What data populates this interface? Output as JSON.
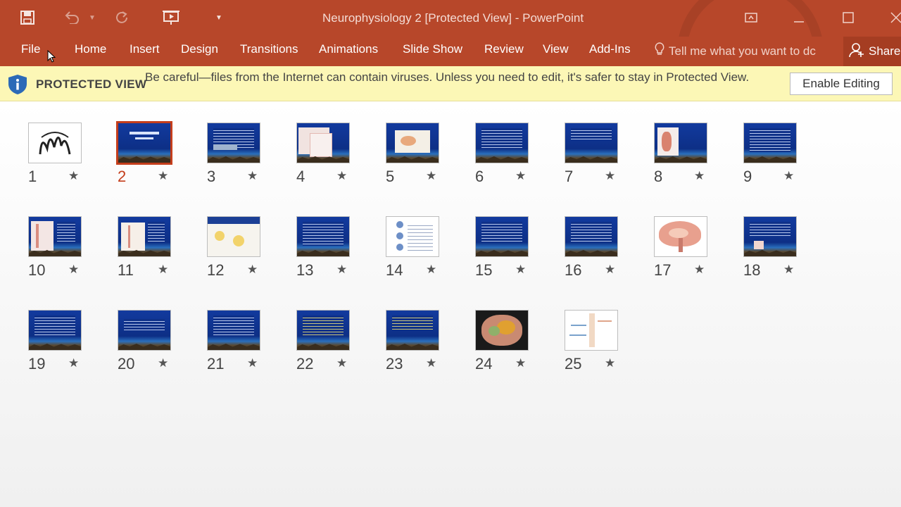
{
  "window": {
    "title": "Neurophysiology 2 [Protected View] - PowerPoint"
  },
  "quick_access": [
    "save-icon",
    "undo-icon",
    "dropdown-caret-icon",
    "redo-icon",
    "present-icon",
    "customize-icon"
  ],
  "ribbon": {
    "tabs": [
      "File",
      "Home",
      "Insert",
      "Design",
      "Transitions",
      "Animations",
      "Slide Show",
      "Review",
      "View",
      "Add-Ins"
    ],
    "tell_me": "Tell me what you want to dc",
    "share": "Share"
  },
  "protected_view": {
    "label": "PROTECTED VIEW",
    "message": "Be careful—files from the Internet can contain viruses. Unless you need to edit, it's safer to stay in Protected View.",
    "button": "Enable Editing"
  },
  "slides": {
    "selected": 2,
    "items": [
      {
        "number": "1"
      },
      {
        "number": "2"
      },
      {
        "number": "3"
      },
      {
        "number": "4"
      },
      {
        "number": "5"
      },
      {
        "number": "6"
      },
      {
        "number": "7"
      },
      {
        "number": "8"
      },
      {
        "number": "9"
      },
      {
        "number": "10"
      },
      {
        "number": "11"
      },
      {
        "number": "12"
      },
      {
        "number": "13"
      },
      {
        "number": "14"
      },
      {
        "number": "15"
      },
      {
        "number": "16"
      },
      {
        "number": "17"
      },
      {
        "number": "18"
      },
      {
        "number": "19"
      },
      {
        "number": "20"
      },
      {
        "number": "21"
      },
      {
        "number": "22"
      },
      {
        "number": "23"
      },
      {
        "number": "24"
      },
      {
        "number": "25"
      }
    ]
  },
  "colors": {
    "accent": "#b7472a",
    "selection": "#c43e1c",
    "banner": "#fcf7b6"
  }
}
